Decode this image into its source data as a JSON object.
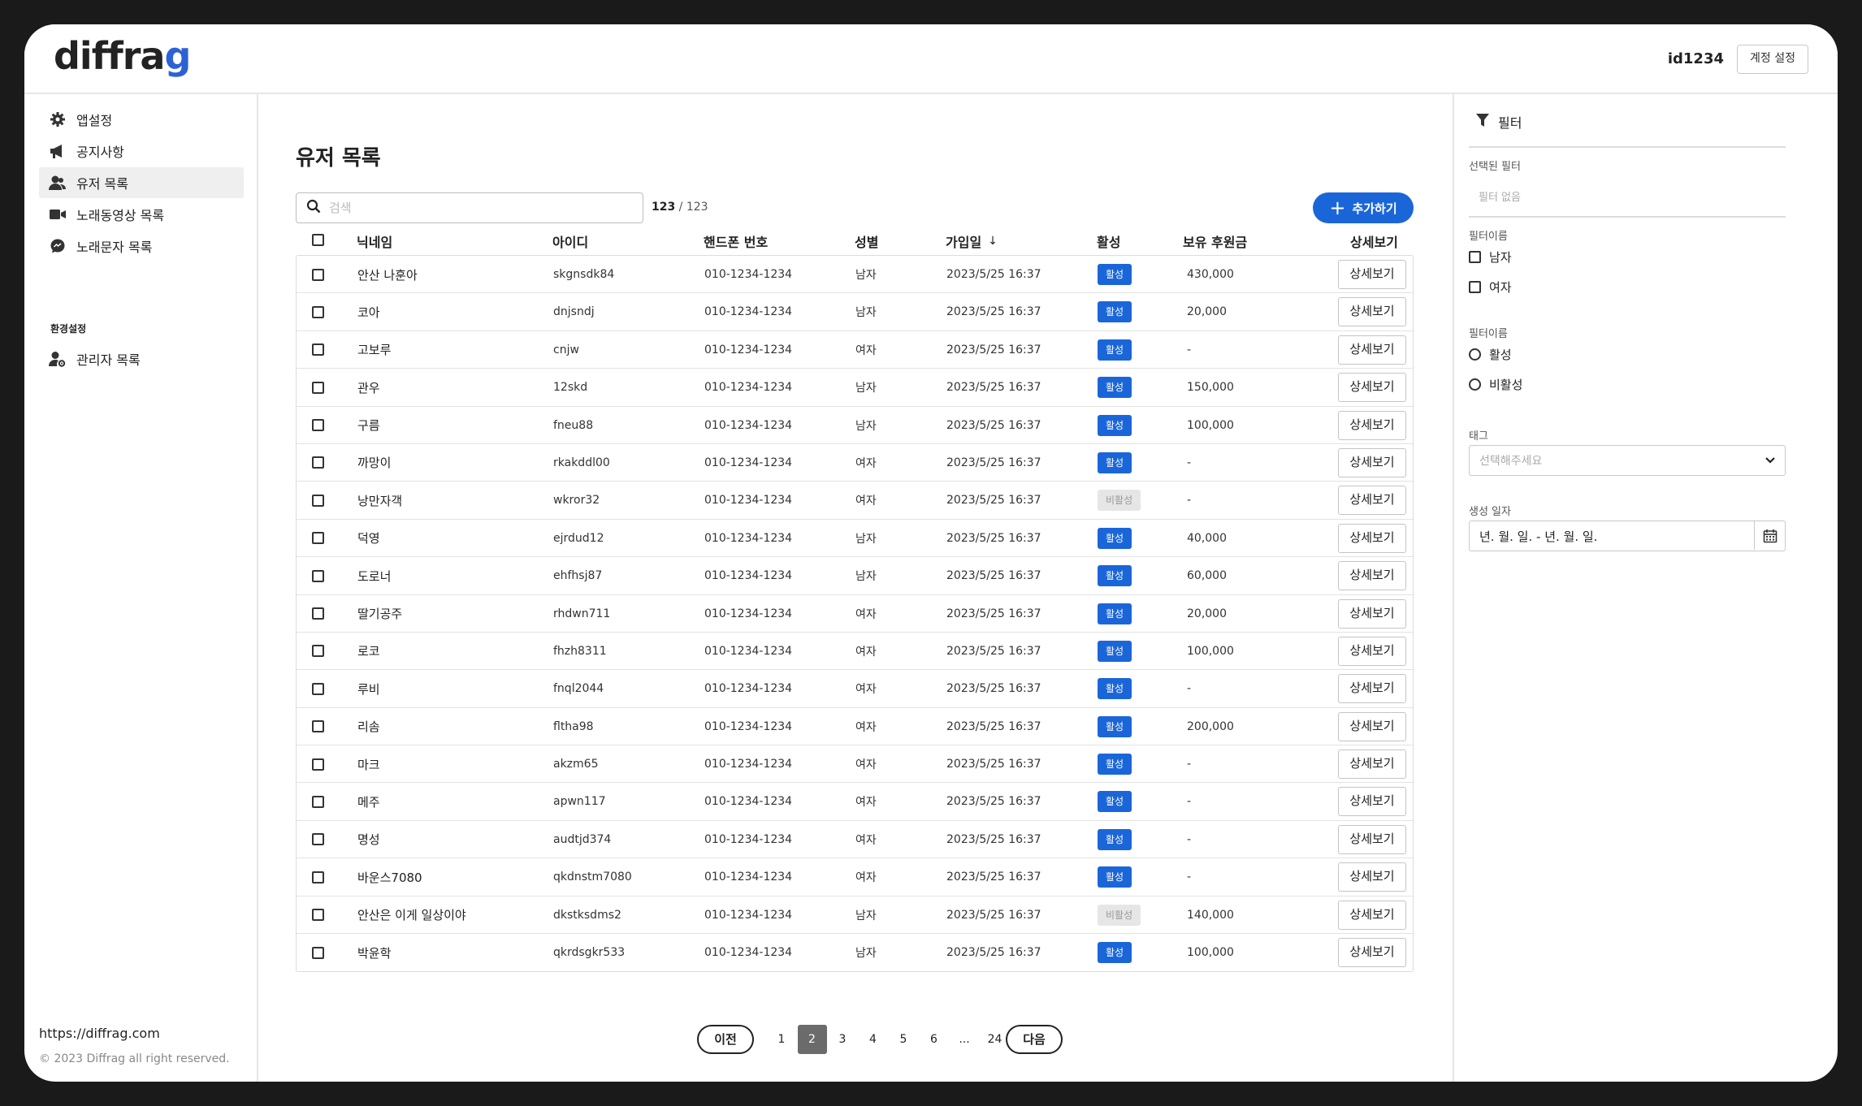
{
  "header": {
    "logo": {
      "prefix": "diffra",
      "suffix": "g"
    },
    "user_id": "id1234",
    "account_button": "계정 설정"
  },
  "sidebar": {
    "items": [
      {
        "label": "앱설정",
        "icon": "gear-icon"
      },
      {
        "label": "공지사항",
        "icon": "megaphone-icon"
      },
      {
        "label": "유저 목록",
        "icon": "users-icon",
        "active": true
      },
      {
        "label": "노래동영상 목록",
        "icon": "video-camera-icon"
      },
      {
        "label": "노래문자 목록",
        "icon": "chat-bubble-icon"
      }
    ],
    "section_title": "환경설정",
    "section_items": [
      {
        "label": "관리자 목록",
        "icon": "admin-user-icon"
      }
    ],
    "site_url": "https://diffrag.com",
    "copyright": "© 2023 Diffrag all right reserved."
  },
  "main": {
    "title": "유저 목록",
    "search": {
      "placeholder": "검색"
    },
    "count": {
      "shown": "123",
      "total": " / 123"
    },
    "add_button": "추가하기",
    "columns": {
      "nickname": "닉네임",
      "id": "아이디",
      "phone": "핸드폰 번호",
      "gender": "성별",
      "joined": "가입일",
      "active": "활성",
      "donation": "보유 후원금",
      "detail": "상세보기"
    },
    "rows": [
      {
        "nickname": "안산 나훈아",
        "id": "skgnsdk84",
        "phone": "010-1234-1234",
        "gender": "남자",
        "joined": "2023/5/25 16:37",
        "status": "활성",
        "active": true,
        "donation": "430,000",
        "detail": "상세보기"
      },
      {
        "nickname": "코아",
        "id": "dnjsndj",
        "phone": "010-1234-1234",
        "gender": "남자",
        "joined": "2023/5/25 16:37",
        "status": "활성",
        "active": true,
        "donation": "20,000",
        "detail": "상세보기"
      },
      {
        "nickname": "고보루",
        "id": "cnjw",
        "phone": "010-1234-1234",
        "gender": "여자",
        "joined": "2023/5/25 16:37",
        "status": "활성",
        "active": true,
        "donation": "-",
        "detail": "상세보기"
      },
      {
        "nickname": "관우",
        "id": "12skd",
        "phone": "010-1234-1234",
        "gender": "남자",
        "joined": "2023/5/25 16:37",
        "status": "활성",
        "active": true,
        "donation": "150,000",
        "detail": "상세보기"
      },
      {
        "nickname": "구름",
        "id": "fneu88",
        "phone": "010-1234-1234",
        "gender": "남자",
        "joined": "2023/5/25 16:37",
        "status": "활성",
        "active": true,
        "donation": "100,000",
        "detail": "상세보기"
      },
      {
        "nickname": "까망이",
        "id": "rkakddl00",
        "phone": "010-1234-1234",
        "gender": "여자",
        "joined": "2023/5/25 16:37",
        "status": "활성",
        "active": true,
        "donation": "-",
        "detail": "상세보기"
      },
      {
        "nickname": "낭만자객",
        "id": "wkror32",
        "phone": "010-1234-1234",
        "gender": "여자",
        "joined": "2023/5/25 16:37",
        "status": "비활성",
        "active": false,
        "donation": "-",
        "detail": "상세보기"
      },
      {
        "nickname": "덕영",
        "id": "ejrdud12",
        "phone": "010-1234-1234",
        "gender": "남자",
        "joined": "2023/5/25 16:37",
        "status": "활성",
        "active": true,
        "donation": "40,000",
        "detail": "상세보기"
      },
      {
        "nickname": "도로너",
        "id": "ehfhsj87",
        "phone": "010-1234-1234",
        "gender": "남자",
        "joined": "2023/5/25 16:37",
        "status": "활성",
        "active": true,
        "donation": "60,000",
        "detail": "상세보기"
      },
      {
        "nickname": "딸기공주",
        "id": "rhdwn711",
        "phone": "010-1234-1234",
        "gender": "여자",
        "joined": "2023/5/25 16:37",
        "status": "활성",
        "active": true,
        "donation": "20,000",
        "detail": "상세보기"
      },
      {
        "nickname": "로코",
        "id": "fhzh8311",
        "phone": "010-1234-1234",
        "gender": "여자",
        "joined": "2023/5/25 16:37",
        "status": "활성",
        "active": true,
        "donation": "100,000",
        "detail": "상세보기"
      },
      {
        "nickname": "루비",
        "id": "fnql2044",
        "phone": "010-1234-1234",
        "gender": "여자",
        "joined": "2023/5/25 16:37",
        "status": "활성",
        "active": true,
        "donation": "-",
        "detail": "상세보기"
      },
      {
        "nickname": "리솜",
        "id": "fltha98",
        "phone": "010-1234-1234",
        "gender": "여자",
        "joined": "2023/5/25 16:37",
        "status": "활성",
        "active": true,
        "donation": "200,000",
        "detail": "상세보기"
      },
      {
        "nickname": "마크",
        "id": "akzm65",
        "phone": "010-1234-1234",
        "gender": "여자",
        "joined": "2023/5/25 16:37",
        "status": "활성",
        "active": true,
        "donation": "-",
        "detail": "상세보기"
      },
      {
        "nickname": "메주",
        "id": "apwn117",
        "phone": "010-1234-1234",
        "gender": "여자",
        "joined": "2023/5/25 16:37",
        "status": "활성",
        "active": true,
        "donation": "-",
        "detail": "상세보기"
      },
      {
        "nickname": "명성",
        "id": "audtjd374",
        "phone": "010-1234-1234",
        "gender": "여자",
        "joined": "2023/5/25 16:37",
        "status": "활성",
        "active": true,
        "donation": "-",
        "detail": "상세보기"
      },
      {
        "nickname": "바운스7080",
        "id": "qkdnstm7080",
        "phone": "010-1234-1234",
        "gender": "여자",
        "joined": "2023/5/25 16:37",
        "status": "활성",
        "active": true,
        "donation": "-",
        "detail": "상세보기"
      },
      {
        "nickname": "안산은 이게 일상이야",
        "id": "dkstksdms2",
        "phone": "010-1234-1234",
        "gender": "남자",
        "joined": "2023/5/25 16:37",
        "status": "비활성",
        "active": false,
        "donation": "140,000",
        "detail": "상세보기"
      },
      {
        "nickname": "박윤학",
        "id": "qkrdsgkr533",
        "phone": "010-1234-1234",
        "gender": "남자",
        "joined": "2023/5/25 16:37",
        "status": "활성",
        "active": true,
        "donation": "100,000",
        "detail": "상세보기"
      }
    ],
    "pagination": {
      "prev": "이전",
      "next": "다음",
      "pages": [
        "1",
        "2",
        "3",
        "4",
        "5",
        "6",
        "...",
        "24"
      ],
      "current": "2"
    }
  },
  "filter": {
    "title": "필터",
    "selected_label": "선택된 필터",
    "selected_empty": "필터 없음",
    "group1_label": "필터이름",
    "group1_options": [
      "남자",
      "여자"
    ],
    "group2_label": "필터이름",
    "group2_options": [
      "활성",
      "비활성"
    ],
    "tag_label": "태그",
    "tag_placeholder": "선택해주세요",
    "date_label": "생성 일자",
    "date_value": "년. 월. 일. - 년. 월. 일."
  },
  "colors": {
    "accent": "#1a66d9",
    "inactive_badge": "#e6e6e6",
    "page_current": "#6b6b6b"
  }
}
